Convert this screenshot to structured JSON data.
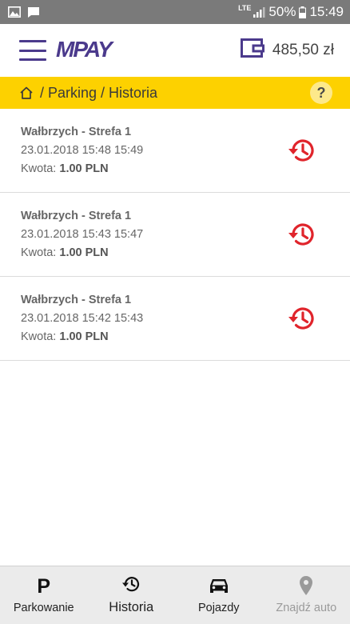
{
  "status": {
    "network": "LTE",
    "battery": "50%",
    "time": "15:49"
  },
  "header": {
    "logo_text": "MPAY",
    "balance": "485,50 zł"
  },
  "breadcrumb": {
    "path": "/ Parking / Historia",
    "help_label": "?"
  },
  "history": [
    {
      "title": "Wałbrzych - Strefa 1",
      "datetime": "23.01.2018 15:48 15:49",
      "amount_label": "Kwota:",
      "amount_value": "1.00 PLN"
    },
    {
      "title": "Wałbrzych - Strefa 1",
      "datetime": "23.01.2018 15:43 15:47",
      "amount_label": "Kwota:",
      "amount_value": "1.00 PLN"
    },
    {
      "title": "Wałbrzych - Strefa 1",
      "datetime": "23.01.2018 15:42 15:43",
      "amount_label": "Kwota:",
      "amount_value": "1.00 PLN"
    }
  ],
  "bottom_nav": [
    {
      "label": "Parkowanie",
      "icon": "parking-icon"
    },
    {
      "label": "Historia",
      "icon": "history-icon"
    },
    {
      "label": "Pojazdy",
      "icon": "car-icon"
    },
    {
      "label": "Znajdź auto",
      "icon": "location-pin-icon"
    }
  ],
  "colors": {
    "brand_purple": "#4b3a8c",
    "accent_yellow": "#fdd100",
    "history_red": "#e0242b",
    "status_bar": "#7a7a7a"
  }
}
